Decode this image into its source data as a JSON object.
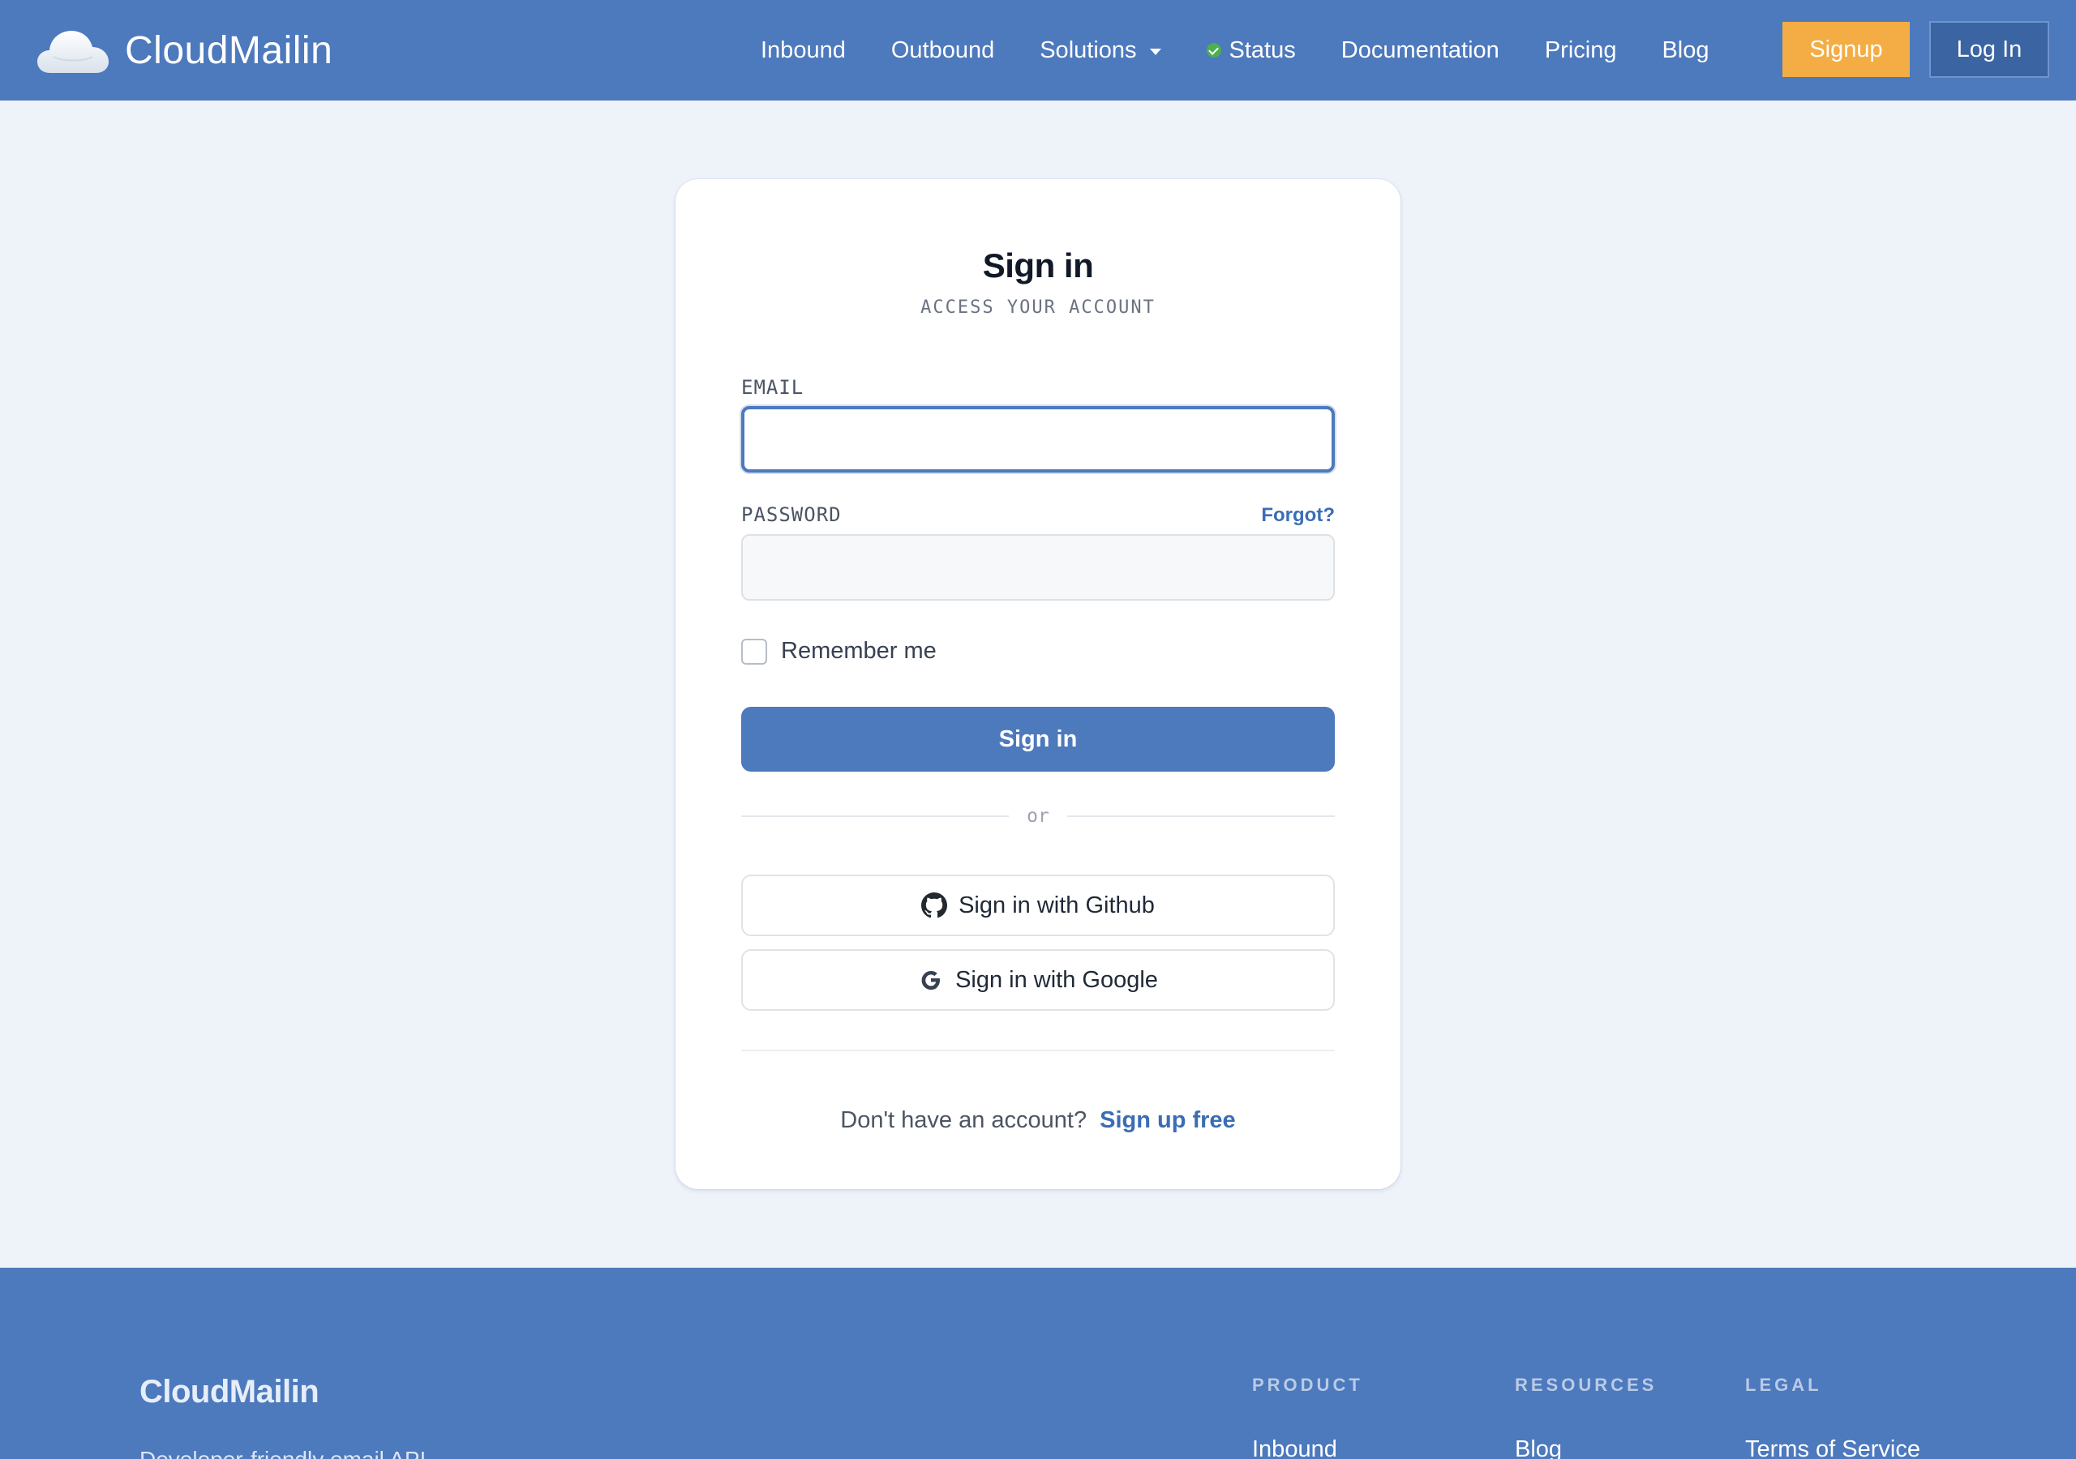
{
  "header": {
    "brand_name": "CloudMailin",
    "nav": [
      {
        "label": "Inbound"
      },
      {
        "label": "Outbound"
      },
      {
        "label": "Solutions"
      },
      {
        "label": "Status"
      },
      {
        "label": "Documentation"
      },
      {
        "label": "Pricing"
      },
      {
        "label": "Blog"
      }
    ],
    "signup_label": "Signup",
    "login_label": "Log In"
  },
  "signin": {
    "title": "Sign in",
    "subtitle": "ACCESS YOUR ACCOUNT",
    "email_label": "EMAIL",
    "email_value": "",
    "password_label": "PASSWORD",
    "forgot_label": "Forgot?",
    "password_value": "",
    "remember_label": "Remember me",
    "remember_checked": false,
    "submit_label": "Sign in",
    "divider_text": "or",
    "github_label": "Sign in with Github",
    "google_label": "Sign in with Google",
    "signup_prompt": "Don't have an account?",
    "signup_link": "Sign up free"
  },
  "footer": {
    "brand_name": "CloudMailin",
    "tagline": "Developer-friendly email API",
    "columns": [
      {
        "heading": "PRODUCT",
        "first_link": "Inbound"
      },
      {
        "heading": "RESOURCES",
        "first_link": "Blog"
      },
      {
        "heading": "LEGAL",
        "first_link": "Terms of Service"
      }
    ]
  },
  "colors": {
    "brand_blue": "#4d79bd",
    "signup_orange": "#f4ad44",
    "login_dark_blue": "#3b64a3",
    "page_background": "#eef3fa",
    "status_green": "#4caf50",
    "link_blue": "#3b6db5"
  },
  "icons": {
    "brand": "cloud-logo-icon",
    "status": "check-circle-icon",
    "solutions_dropdown": "caret-down-icon",
    "github": "github-icon",
    "google": "google-icon"
  }
}
